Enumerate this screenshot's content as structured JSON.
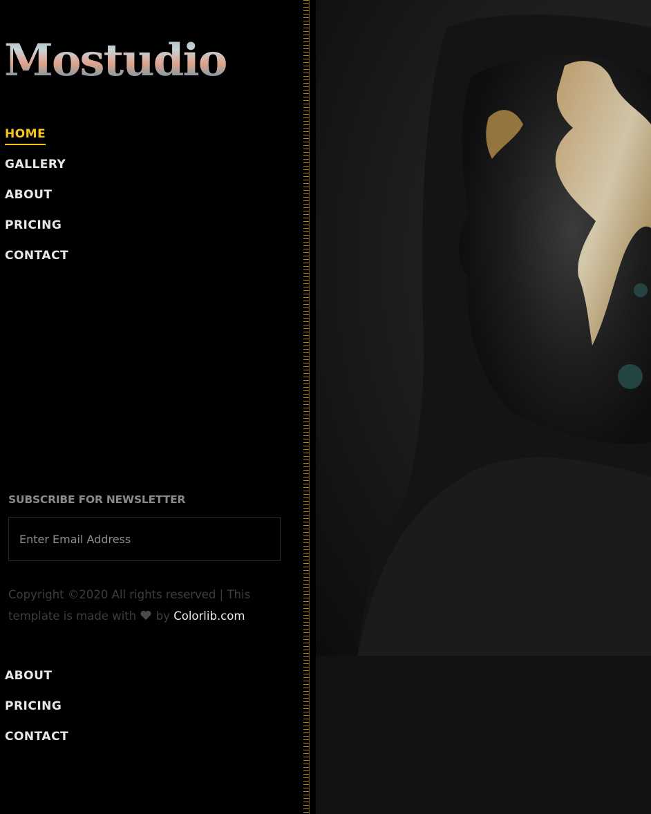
{
  "brand": {
    "logo_text": "Mostudio"
  },
  "nav_primary": [
    {
      "label": "HOME",
      "active": true
    },
    {
      "label": "GALLERY",
      "active": false
    },
    {
      "label": "ABOUT",
      "active": false
    },
    {
      "label": "PRICING",
      "active": false
    },
    {
      "label": "CONTACT",
      "active": false
    }
  ],
  "newsletter": {
    "title": "SUBSCRIBE FOR NEWSLETTER",
    "placeholder": "Enter Email Address"
  },
  "footer": {
    "copyright_text": "Copyright ©2020 All rights reserved | This template is made with",
    "heart_icon": "heart-icon",
    "by_text": "by",
    "link_text": "Colorlib.com"
  },
  "nav_secondary": [
    {
      "label": "ABOUT"
    },
    {
      "label": "PRICING"
    },
    {
      "label": "CONTACT"
    }
  ],
  "colors": {
    "accent": "#f5c518",
    "background": "#000000",
    "content_background": "#121212"
  },
  "hero": {
    "image_subject": "portrait-photo"
  }
}
